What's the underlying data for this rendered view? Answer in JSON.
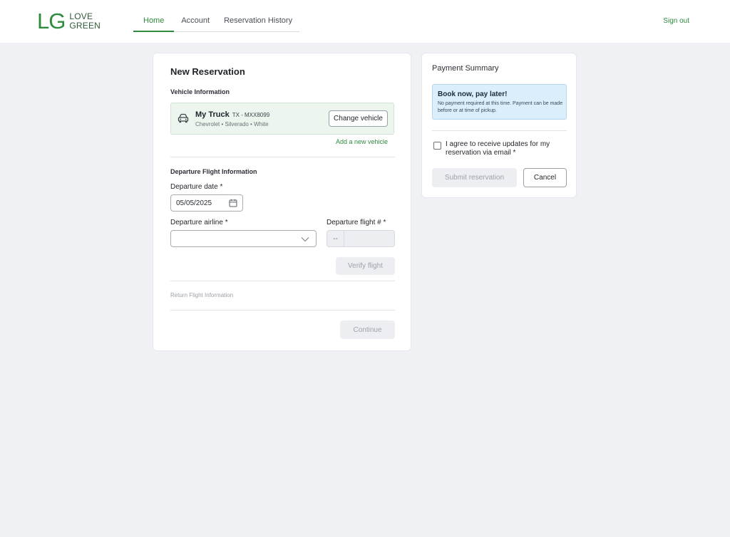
{
  "brand": {
    "mark": "LG",
    "line1": "LOVE",
    "line2": "GREEN"
  },
  "nav": {
    "tabs": [
      {
        "label": "Home"
      },
      {
        "label": "Account"
      },
      {
        "label": "Reservation History"
      }
    ]
  },
  "header": {
    "signout": "Sign out"
  },
  "reservation": {
    "title": "New Reservation",
    "vehicle": {
      "section": "Vehicle Information",
      "name": "My Truck",
      "plate": "TX - MXX8099",
      "details": "Chevrolet  • Silverado • White",
      "change_label": "Change vehicle",
      "add_label": "Add a new vehicle"
    },
    "departure": {
      "section": "Departure Flight Information",
      "date_label": "Departure date *",
      "date_value": "05/05/2025",
      "airline_label": "Departure airline *",
      "airline_value": "",
      "flight_label": "Departure flight # *",
      "flight_prefix": "--",
      "verify_label": "Verify flight"
    },
    "return": {
      "section": "Return Flight Information"
    },
    "continue_label": "Continue"
  },
  "payment": {
    "title": "Payment Summary",
    "notice_title": "Book now, pay later!",
    "notice_body": "No payment required at this time. Payment can be made before or at time of pickup.",
    "agree_text": "I agree to receive updates for my reservation via email *",
    "submit_label": "Submit reservation",
    "cancel_label": "Cancel"
  },
  "colors": {
    "accent": "#2e8b3e",
    "background": "#f0f1f4",
    "notice": "#dbeefc"
  }
}
